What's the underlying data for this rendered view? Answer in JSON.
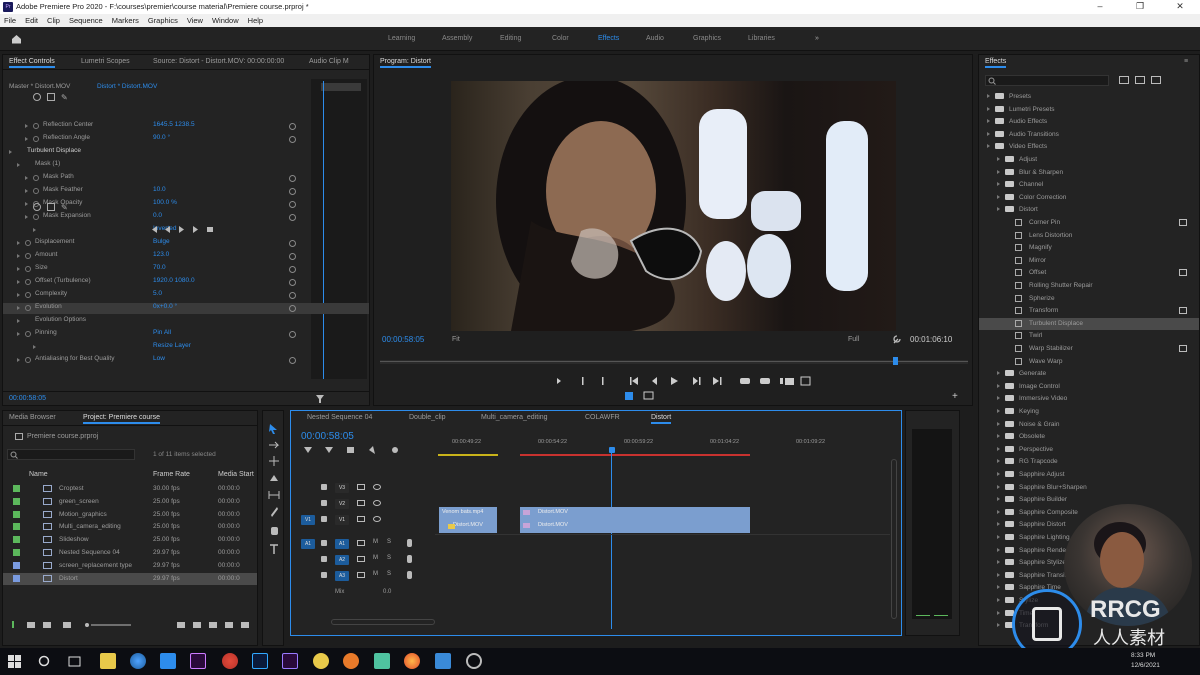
{
  "window": {
    "title": "Adobe Premiere Pro 2020 - F:\\courses\\premier\\course material\\Premiere course.prproj *",
    "app_icon": "Pr"
  },
  "menu": [
    "File",
    "Edit",
    "Clip",
    "Sequence",
    "Markers",
    "Graphics",
    "View",
    "Window",
    "Help"
  ],
  "workspaces": [
    "Learning",
    "Assembly",
    "Editing",
    "Color",
    "Effects",
    "Audio",
    "Graphics",
    "Libraries"
  ],
  "workspace_active": "Effects",
  "effect_controls": {
    "tabs": [
      "Effect Controls",
      "Lumetri Scopes",
      "Source: Distort - Distort.MOV: 00:00:00:00",
      "Audio Clip M"
    ],
    "clip_label": "Master * Distort.MOV",
    "clip_target": "Distort * Distort.MOV",
    "timecode": "00:00:58:05",
    "rows": [
      {
        "name": "Reflection Center",
        "value": "1645.5    1238.5"
      },
      {
        "name": "Reflection Angle",
        "value": "90.0 °"
      },
      {
        "name": "Turbulent Displace",
        "value": ""
      },
      {
        "name": "Mask (1)",
        "value": ""
      },
      {
        "name": "Mask Path",
        "value": ""
      },
      {
        "name": "Mask Feather",
        "value": "10.0"
      },
      {
        "name": "Mask Opacity",
        "value": "100.0 %"
      },
      {
        "name": "Mask Expansion",
        "value": "0.0"
      },
      {
        "name": "",
        "value": "Inverted"
      },
      {
        "name": "Displacement",
        "value": "Bulge"
      },
      {
        "name": "Amount",
        "value": "123.0"
      },
      {
        "name": "Size",
        "value": "70.0"
      },
      {
        "name": "Offset (Turbulence)",
        "value": "1920.0    1080.0"
      },
      {
        "name": "Complexity",
        "value": "5.0"
      },
      {
        "name": "Evolution",
        "value": "0x+0.0 °"
      },
      {
        "name": "Evolution Options",
        "value": ""
      },
      {
        "name": "Pinning",
        "value": "Pin All"
      },
      {
        "name": "",
        "value": "Resize Layer"
      },
      {
        "name": "Antialiasing for Best Quality",
        "value": "Low"
      }
    ]
  },
  "program": {
    "title": "Program: Distort",
    "timecode": "00:00:58:05",
    "fit": "Fit",
    "quality": "Full",
    "duration": "00:01:06:10"
  },
  "project": {
    "tabs": [
      "Media Browser",
      "Project: Premiere course"
    ],
    "file": "Premiere course.prproj",
    "count": "1 of 11 items selected",
    "columns": [
      "Name",
      "Frame Rate",
      "Media Start"
    ],
    "items": [
      {
        "name": "Croptest",
        "rate": "30.00 fps",
        "start": "00:00:0",
        "color": "#5cb85c"
      },
      {
        "name": "green_screen",
        "rate": "25.00 fps",
        "start": "00:00:0",
        "color": "#5cb85c"
      },
      {
        "name": "Motion_graphics",
        "rate": "25.00 fps",
        "start": "00:00:0",
        "color": "#5cb85c"
      },
      {
        "name": "Multi_camera_editing",
        "rate": "25.00 fps",
        "start": "00:00:0",
        "color": "#5cb85c"
      },
      {
        "name": "Slideshow",
        "rate": "25.00 fps",
        "start": "00:00:0",
        "color": "#5cb85c"
      },
      {
        "name": "Nested Sequence 04",
        "rate": "29.97 fps",
        "start": "00:00:0",
        "color": "#5cb85c"
      },
      {
        "name": "screen_replacement type",
        "rate": "29.97 fps",
        "start": "00:00:0",
        "color": "#7a9be0"
      },
      {
        "name": "Distort",
        "rate": "29.97 fps",
        "start": "00:00:0",
        "color": "#7a9be0"
      }
    ]
  },
  "timeline": {
    "tabs": [
      "Nested Sequence 04",
      "Double_clip",
      "Multi_camera_editing",
      "COLAWFR",
      "Distort"
    ],
    "active_tab": "Distort",
    "timecode": "00:00:58:05",
    "ruler": [
      "00:00:49:22",
      "00:00:54:22",
      "00:00:59:22",
      "00:01:04:22",
      "00:01:09:22"
    ],
    "video_tracks": [
      "V3",
      "V2",
      "V1"
    ],
    "audio_tracks": [
      "A1",
      "A2",
      "A3"
    ],
    "mix": "Mix",
    "mix_value": "0.0",
    "clips": [
      {
        "label": "Venom bats.mp4",
        "track": "V2"
      },
      {
        "label": "Distort.MOV",
        "track": "V1"
      },
      {
        "label": "Distort.MOV",
        "track": "V2"
      },
      {
        "label": "Distort.MOV",
        "track": "V1"
      }
    ]
  },
  "effects": {
    "title": "Effects",
    "tree": [
      {
        "label": "Presets",
        "level": 0
      },
      {
        "label": "Lumetri Presets",
        "level": 0
      },
      {
        "label": "Audio Effects",
        "level": 0
      },
      {
        "label": "Audio Transitions",
        "level": 0
      },
      {
        "label": "Video Effects",
        "level": 0
      },
      {
        "label": "Adjust",
        "level": 1
      },
      {
        "label": "Blur & Sharpen",
        "level": 1
      },
      {
        "label": "Channel",
        "level": 1
      },
      {
        "label": "Color Correction",
        "level": 1
      },
      {
        "label": "Distort",
        "level": 1
      },
      {
        "label": "Corner Pin",
        "level": 2
      },
      {
        "label": "Lens Distortion",
        "level": 2
      },
      {
        "label": "Magnify",
        "level": 2
      },
      {
        "label": "Mirror",
        "level": 2
      },
      {
        "label": "Offset",
        "level": 2
      },
      {
        "label": "Rolling Shutter Repair",
        "level": 2
      },
      {
        "label": "Spherize",
        "level": 2
      },
      {
        "label": "Transform",
        "level": 2
      },
      {
        "label": "Turbulent Displace",
        "level": 2
      },
      {
        "label": "Twirl",
        "level": 2
      },
      {
        "label": "Warp Stabilizer",
        "level": 2
      },
      {
        "label": "Wave Warp",
        "level": 2
      },
      {
        "label": "Generate",
        "level": 1
      },
      {
        "label": "Image Control",
        "level": 1
      },
      {
        "label": "Immersive Video",
        "level": 1
      },
      {
        "label": "Keying",
        "level": 1
      },
      {
        "label": "Noise & Grain",
        "level": 1
      },
      {
        "label": "Obsolete",
        "level": 1
      },
      {
        "label": "Perspective",
        "level": 1
      },
      {
        "label": "RG Trapcode",
        "level": 1
      },
      {
        "label": "Sapphire Adjust",
        "level": 1
      },
      {
        "label": "Sapphire Blur+Sharpen",
        "level": 1
      },
      {
        "label": "Sapphire Builder",
        "level": 1
      },
      {
        "label": "Sapphire Composite",
        "level": 1
      },
      {
        "label": "Sapphire Distort",
        "level": 1
      },
      {
        "label": "Sapphire Lighting",
        "level": 1
      },
      {
        "label": "Sapphire Render",
        "level": 1
      },
      {
        "label": "Sapphire Stylize",
        "level": 1
      },
      {
        "label": "Sapphire Transitions",
        "level": 1
      },
      {
        "label": "Sapphire Time",
        "level": 1
      },
      {
        "label": "Stylize",
        "level": 1
      },
      {
        "label": "Time",
        "level": 1
      },
      {
        "label": "Transform",
        "level": 1
      }
    ],
    "selected": "Turbulent Displace"
  },
  "watermark": {
    "brand": "RRCG",
    "cn": "人人素材"
  },
  "taskbar": {
    "time": "8:33 PM",
    "date": "12/6/2021"
  },
  "colors": {
    "accent": "#2d8ceb",
    "clip_blue": "#7b9ecf",
    "clip_pink": "#c7a4d8",
    "work_area_red": "#c8322f"
  }
}
